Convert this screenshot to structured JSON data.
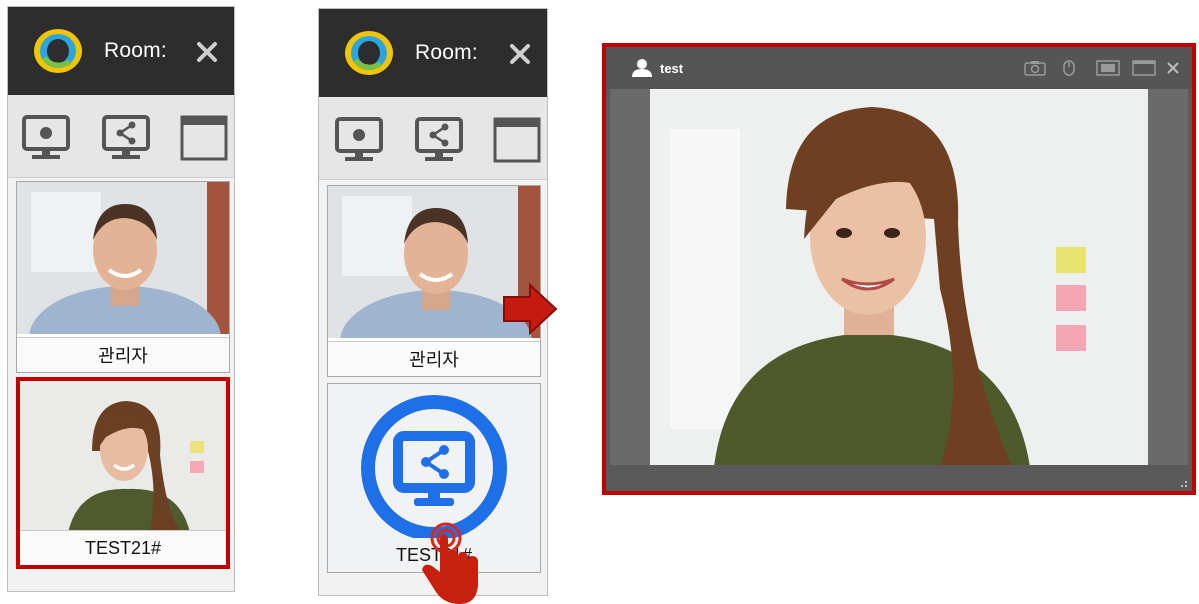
{
  "panel_a": {
    "header": {
      "room_label": "Room:"
    },
    "participants": [
      {
        "name": "관리자",
        "selected": false
      },
      {
        "name": "TEST21#",
        "selected": true
      }
    ]
  },
  "panel_b": {
    "header": {
      "room_label": "Room:"
    },
    "participants": [
      {
        "name": "관리자"
      },
      {
        "name": "TEST21#",
        "overlay_icon": "share-screen-icon"
      }
    ]
  },
  "video_window": {
    "user_name": "test",
    "controls": [
      "camera-icon",
      "mouse-icon",
      "fit-screen-icon",
      "window-icon",
      "close-icon"
    ]
  },
  "colors": {
    "highlight": "#c00000",
    "header_bg": "#2d2d2d",
    "accent_blue": "#1f6fe8"
  }
}
